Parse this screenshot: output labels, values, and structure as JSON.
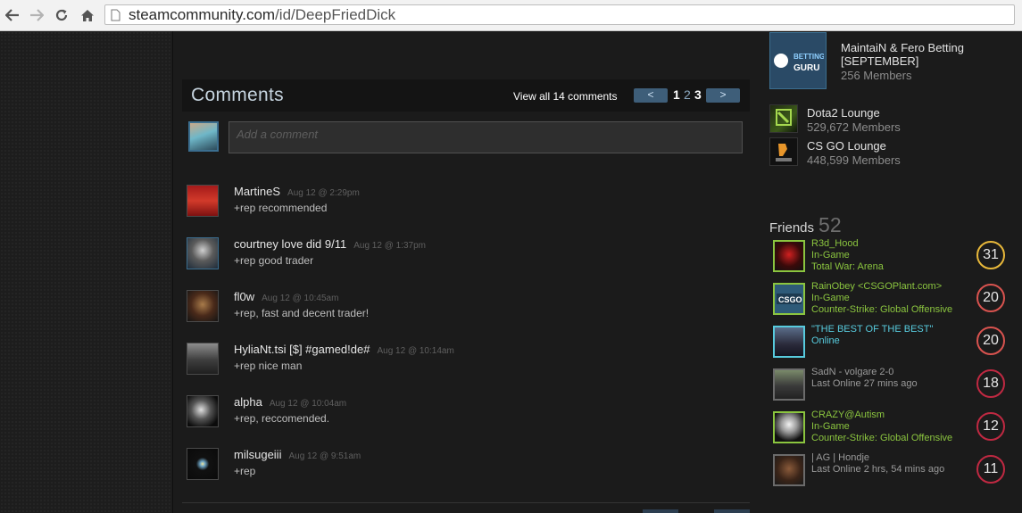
{
  "browser": {
    "url_domain": "steamcommunity.com",
    "url_path": "/id/DeepFriedDick"
  },
  "comments": {
    "title": "Comments",
    "view_all": "View all 14 comments",
    "prev_label": "<",
    "next_label": ">",
    "pages": [
      "1",
      "2",
      "3"
    ],
    "input_placeholder": "Add a comment",
    "items": [
      {
        "author": "MartineS",
        "date": "Aug 12 @ 2:29pm",
        "text": "+rep recommended"
      },
      {
        "author": "courtney love did 9/11",
        "date": "Aug 12 @ 1:37pm",
        "text": "+rep good trader"
      },
      {
        "author": "fl0w",
        "date": "Aug 12 @ 10:45am",
        "text": "+rep, fast and decent trader!"
      },
      {
        "author": "HyliaNt.tsi [$] #gamed!de#",
        "date": "Aug 12 @ 10:14am",
        "text": "+rep nice man"
      },
      {
        "author": "alpha",
        "date": "Aug 12 @ 10:04am",
        "text": "+rep, reccomended."
      },
      {
        "author": "milsugeiii",
        "date": "Aug 12 @ 9:51am",
        "text": "+rep"
      }
    ]
  },
  "groups": [
    {
      "name": "MaintaiN & Fero Betting [SEPTEMBER]",
      "members": "256 Members",
      "logo_text": "BETTING GURU"
    },
    {
      "name": "Dota2 Lounge",
      "members": "529,672 Members",
      "logo_text": "Dota2"
    },
    {
      "name": "CS GO Lounge",
      "members": "448,599 Members",
      "logo_text": "CSGO"
    }
  ],
  "friends": {
    "title": "Friends",
    "count": "52",
    "items": [
      {
        "name": "R3d_Hood",
        "status": "In-Game",
        "game": "Total War: Arena",
        "level": "31",
        "state": "ingame"
      },
      {
        "name": "RainObey <CSGOPlant.com>",
        "status": "In-Game",
        "game": "Counter-Strike: Global Offensive",
        "level": "20",
        "state": "ingame"
      },
      {
        "name": "\"THE BEST OF THE BEST\"",
        "status": "Online",
        "game": "",
        "level": "20",
        "state": "online"
      },
      {
        "name": "SadN - volgare 2-0",
        "status": "Last Online 27 mins ago",
        "game": "",
        "level": "18",
        "state": "offline"
      },
      {
        "name": "CRAZY@Autism",
        "status": "In-Game",
        "game": "Counter-Strike: Global Offensive",
        "level": "12",
        "state": "ingame"
      },
      {
        "name": "| AG | Hondje",
        "status": "Last Online 2 hrs, 54 mins ago",
        "game": "",
        "level": "11",
        "state": "offline"
      }
    ]
  },
  "colors": {
    "level_31": "#e8b83a",
    "level_20": "#d9534f",
    "level_18": "#c02942",
    "ingame": "#8bc53f",
    "online": "#57cbde"
  }
}
